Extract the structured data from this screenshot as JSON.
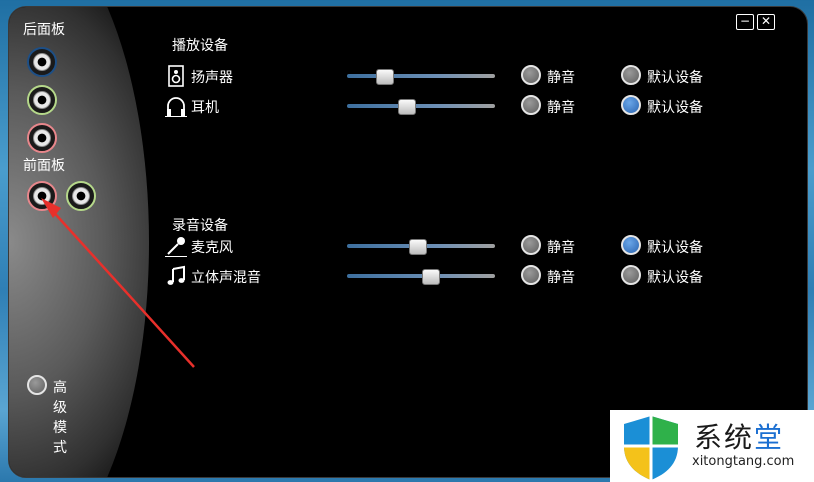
{
  "panel": {
    "rear_label": "后面板",
    "front_label": "前面板",
    "advanced_label": "高级模式"
  },
  "window_buttons": {
    "minimize": "−",
    "close": "✕"
  },
  "playback": {
    "title": "播放设备",
    "devices": [
      {
        "label": "扬声器",
        "icon": "speaker-icon",
        "volume": 0.25,
        "mute_label": "静音",
        "muted": false,
        "default_label": "默认设备",
        "is_default": false
      },
      {
        "label": "耳机",
        "icon": "headphones-icon",
        "volume": 0.4,
        "mute_label": "静音",
        "muted": false,
        "default_label": "默认设备",
        "is_default": true
      }
    ]
  },
  "recording": {
    "title": "录音设备",
    "devices": [
      {
        "label": "麦克风",
        "icon": "microphone-icon",
        "volume": 0.47,
        "mute_label": "静音",
        "muted": false,
        "default_label": "默认设备",
        "is_default": true
      },
      {
        "label": "立体声混音",
        "icon": "music-note-icon",
        "volume": 0.56,
        "mute_label": "静音",
        "muted": false,
        "default_label": "默认设备",
        "is_default": false
      }
    ]
  },
  "watermark": {
    "title_a": "系统",
    "title_b": "堂",
    "url": "xitongtang.com"
  },
  "colors": {
    "accent": "#2a64b0",
    "jack_blue": "#1d4f86",
    "jack_green": "#b5d88a",
    "jack_pink": "#e8878c",
    "arrow": "#e8302b"
  }
}
